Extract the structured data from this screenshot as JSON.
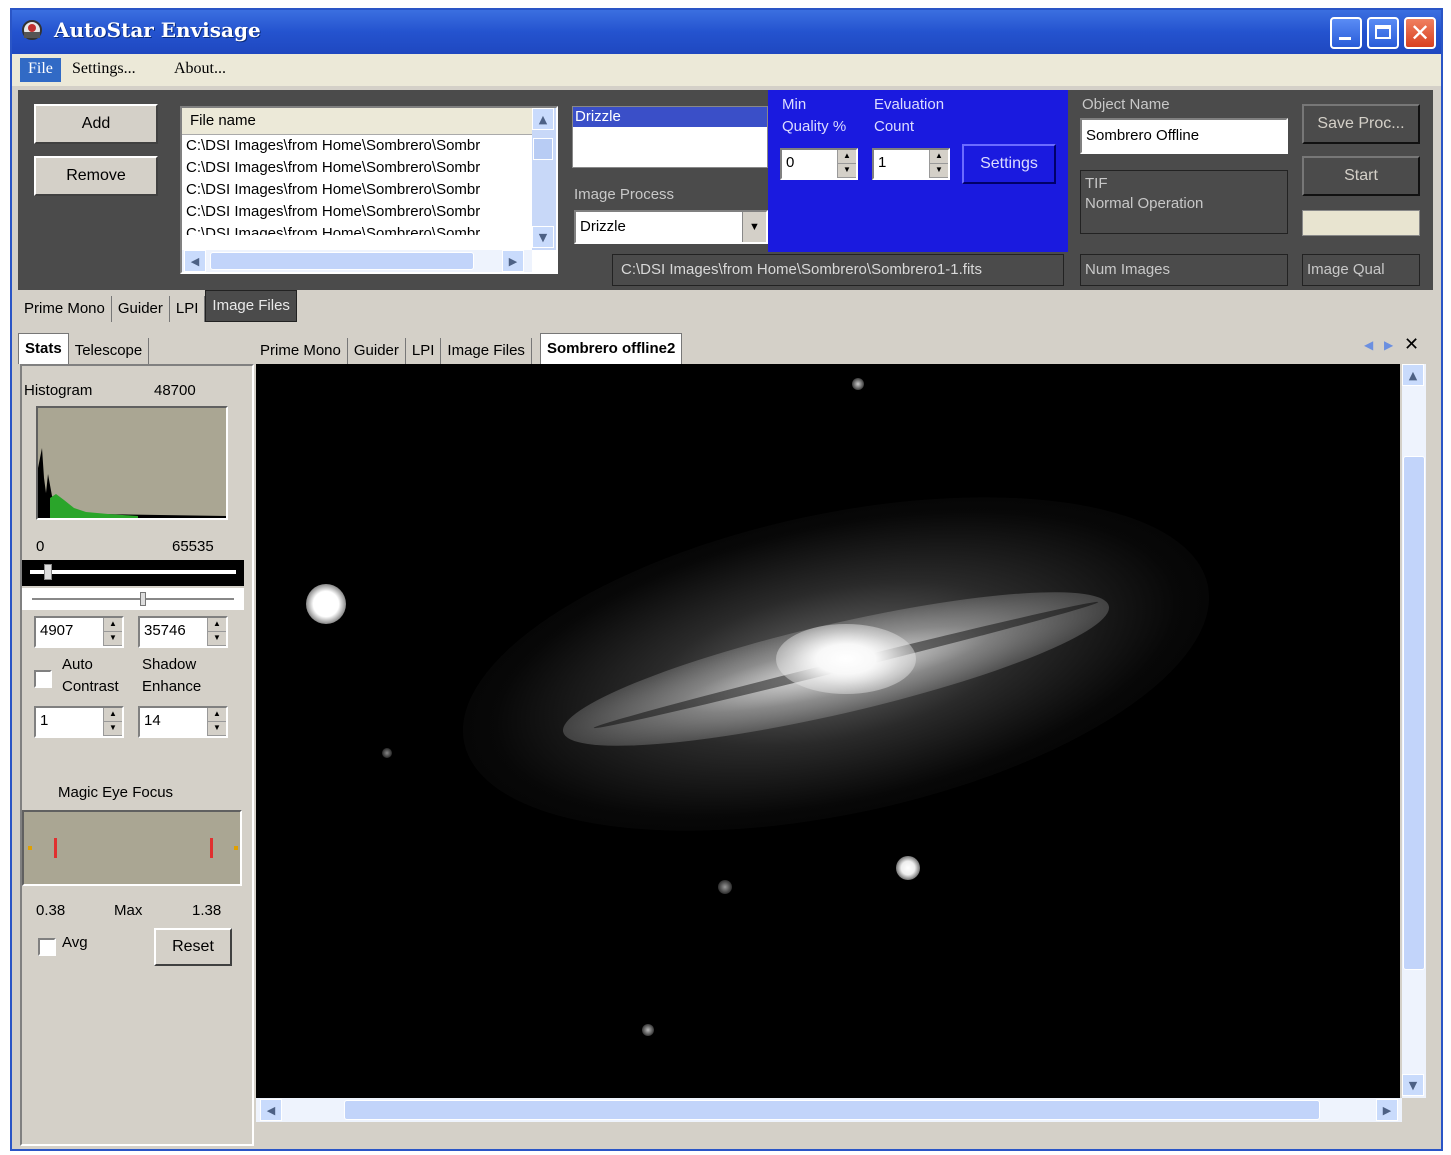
{
  "window": {
    "title": "AutoStar Envisage",
    "controls": [
      "minimize-icon",
      "maximize-icon",
      "close-icon"
    ]
  },
  "menu": {
    "items": [
      "File",
      "Settings...",
      "About..."
    ],
    "active": "File"
  },
  "top_panel": {
    "add_label": "Add",
    "remove_label": "Remove",
    "file_list": {
      "header": "File name",
      "rows": [
        "C:\\DSI Images\\from Home\\Sombrero\\Sombr",
        "C:\\DSI Images\\from Home\\Sombrero\\Sombr",
        "C:\\DSI Images\\from Home\\Sombrero\\Sombr",
        "C:\\DSI Images\\from Home\\Sombrero\\Sombr",
        "C:\\DSI Images\\from Home\\Sombrero\\Sombr"
      ]
    },
    "drizzle_label": "Drizzle",
    "image_process_label": "Image Process",
    "image_process_value": "Drizzle",
    "min_quality_label_1": "Min",
    "min_quality_label_2": "Quality %",
    "min_quality_value": "0",
    "evaluation_label_1": "Evaluation",
    "evaluation_label_2": "Count",
    "evaluation_value": "1",
    "settings_label": "Settings",
    "current_file": "C:\\DSI Images\\from Home\\Sombrero\\Sombrero1-1.fits",
    "object_name_label": "Object Name",
    "object_name_value": "Sombrero Offline",
    "status_line_1": "TIF",
    "status_line_2": "Normal Operation",
    "num_images_label": "Num Images",
    "save_proc_label": "Save Proc...",
    "start_label": "Start",
    "image_qual_label": "Image Qual"
  },
  "tabs_row1": [
    "Prime Mono",
    "Guider",
    "LPI",
    "Image Files"
  ],
  "left_tabs": [
    "Stats",
    "Telescope"
  ],
  "image_tabs": [
    "Prime Mono",
    "Guider",
    "LPI",
    "Image Files",
    "Sombrero offline2"
  ],
  "stats": {
    "histogram_label": "Histogram",
    "histogram_max": "48700",
    "range_min": "0",
    "range_max": "65535",
    "low_value": "4907",
    "high_value": "35746",
    "auto_contrast_1": "Auto",
    "auto_contrast_2": "Contrast",
    "shadow_1": "Shadow",
    "shadow_2": "Enhance",
    "contrast_value": "1",
    "shadow_value": "14",
    "magic_eye_label": "Magic Eye Focus",
    "focus_min": "0.38",
    "focus_max_label": "Max",
    "focus_max": "1.38",
    "avg_label": "Avg",
    "reset_label": "Reset"
  },
  "colors": {
    "title_blue": "#2453cf",
    "panel_dark": "#4b4b4b",
    "blue_panel": "#1a1adf",
    "xp_gray": "#d4d0c8",
    "histogram_bg": "#aaa693"
  }
}
